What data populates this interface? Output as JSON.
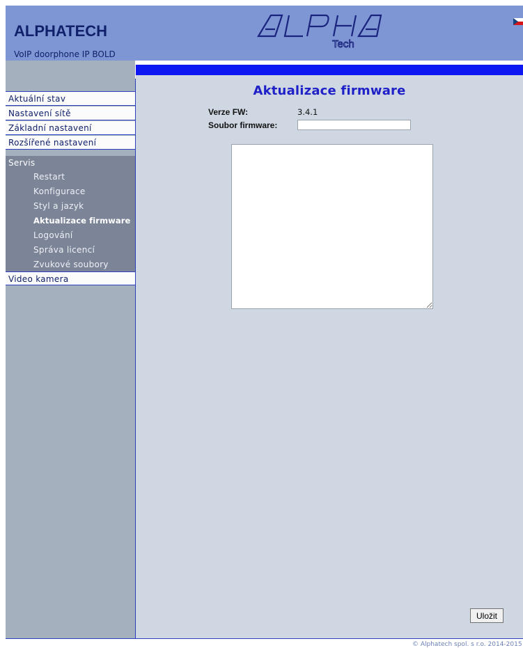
{
  "header": {
    "title": "ALPHATECH",
    "subtitle": "VoIP doorphone IP BOLD",
    "logo_text": "ALPHA",
    "logo_sub": "Tech"
  },
  "sidebar": {
    "items": [
      {
        "label": "Aktuální stav"
      },
      {
        "label": "Nastavení sítě"
      },
      {
        "label": "Základní nastavení"
      },
      {
        "label": "Rozšířené nastavení"
      }
    ],
    "servis": {
      "label": "Servis",
      "items": [
        {
          "label": "Restart"
        },
        {
          "label": "Konfigurace"
        },
        {
          "label": "Styl a jazyk"
        },
        {
          "label": "Aktualizace firmware",
          "active": true
        },
        {
          "label": "Logování"
        },
        {
          "label": "Správa licencí"
        },
        {
          "label": "Zvukové soubory"
        }
      ]
    },
    "video": {
      "label": "Video kamera"
    }
  },
  "main": {
    "title": "Aktualizace firmware",
    "fw_label": "Verze FW:",
    "fw_value": "3.4.1",
    "file_label": "Soubor firmware:",
    "file_value": "",
    "log_value": "",
    "save_label": "Uložit"
  },
  "footer": {
    "text": "© Alphatech spol. s r.o. 2014-2015"
  },
  "colors": {
    "header_bg": "#7f96d4",
    "accent_bar": "#0c17f2",
    "main_bg": "#cfd8e2",
    "title": "#2020c8"
  }
}
